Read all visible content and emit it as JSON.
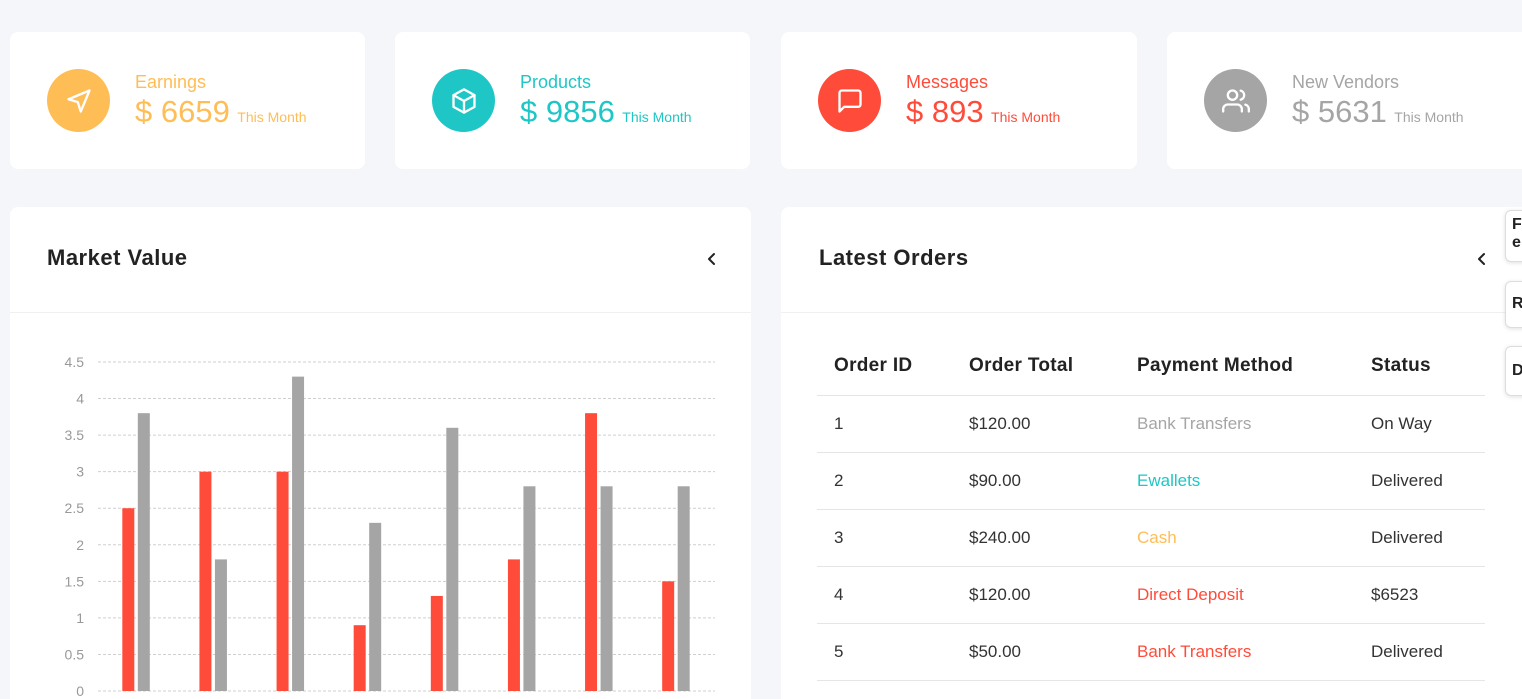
{
  "stats": [
    {
      "label": "Earnings",
      "value": "$ 6659",
      "suffix": "This Month",
      "color": "#ffbd56",
      "icon": "send-icon"
    },
    {
      "label": "Products",
      "value": "$ 9856",
      "suffix": "This Month",
      "color": "#1ec7c6",
      "icon": "box-icon"
    },
    {
      "label": "Messages",
      "value": "$ 893",
      "suffix": "This Month",
      "color": "#ff4b3a",
      "icon": "message-icon"
    },
    {
      "label": "New Vendors",
      "value": "$ 5631",
      "suffix": "This Month",
      "color": "#a5a5a5",
      "icon": "users-icon"
    }
  ],
  "market": {
    "title": "Market Value",
    "collapse_icon": "chevron-left-icon"
  },
  "chart_data": {
    "type": "bar",
    "ylim": [
      0,
      4.5
    ],
    "yticks": [
      "0",
      "0.5",
      "1",
      "1.5",
      "2",
      "2.5",
      "3",
      "3.5",
      "4",
      "4.5"
    ],
    "grid": true,
    "series": [
      {
        "color": "#ff4b3a",
        "values": [
          2.5,
          3.0,
          3.0,
          0.9,
          1.3,
          1.8,
          3.8,
          1.5
        ]
      },
      {
        "color": "#a5a5a5",
        "values": [
          3.8,
          1.8,
          4.3,
          2.3,
          3.6,
          2.8,
          2.8,
          2.8
        ]
      }
    ]
  },
  "orders": {
    "title": "Latest Orders",
    "collapse_icon": "chevron-left-icon",
    "headers": [
      "Order ID",
      "Order Total",
      "Payment Method",
      "Status"
    ],
    "rows": [
      {
        "id": "1",
        "total": "$120.00",
        "method": "Bank Transfers",
        "method_color": "#a5a5a5",
        "status": "On Way"
      },
      {
        "id": "2",
        "total": "$90.00",
        "method": "Ewallets",
        "method_color": "#1ec7c6",
        "status": "Delivered"
      },
      {
        "id": "3",
        "total": "$240.00",
        "method": "Cash",
        "method_color": "#ffbd56",
        "status": "Delivered"
      },
      {
        "id": "4",
        "total": "$120.00",
        "method": "Direct Deposit",
        "method_color": "#ff4b3a",
        "status": "$6523"
      },
      {
        "id": "5",
        "total": "$50.00",
        "method": "Bank Transfers",
        "method_color": "#ff4b3a",
        "status": "Delivered"
      }
    ]
  },
  "side_tabs": [
    "F\ne",
    "R",
    "D"
  ]
}
